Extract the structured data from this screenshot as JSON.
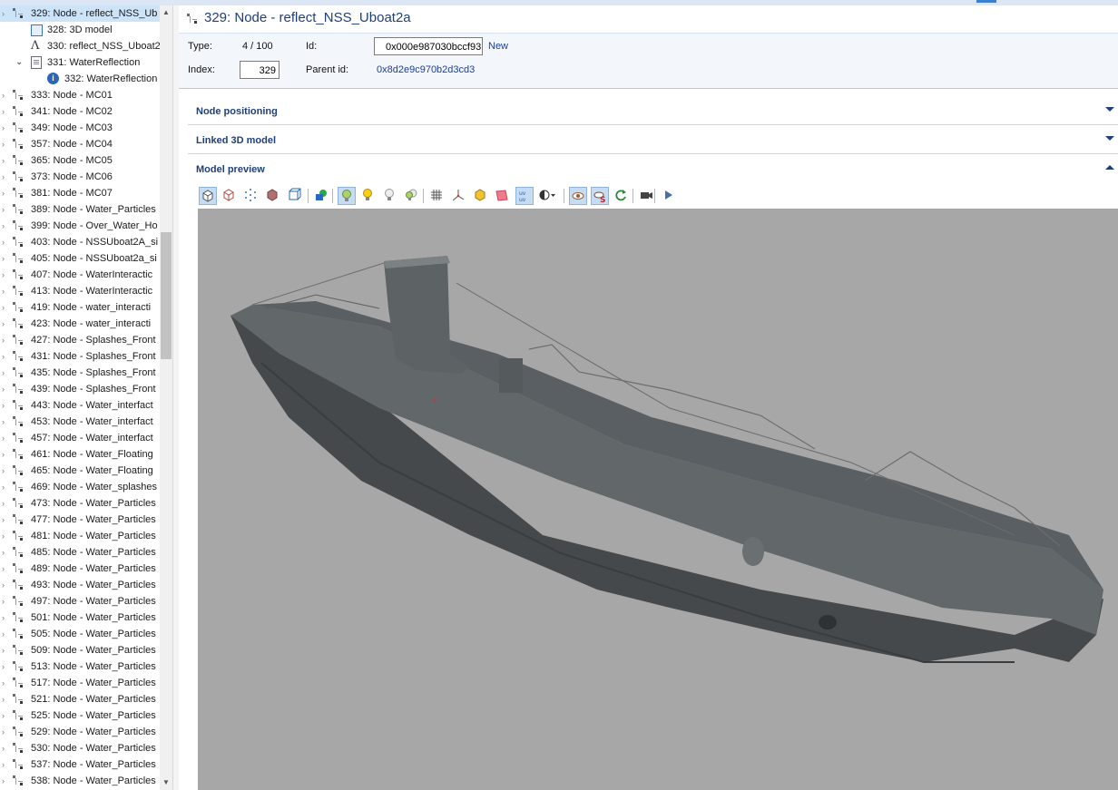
{
  "tree": {
    "items": [
      {
        "label": "329: Node - reflect_NSS_Ub",
        "icon": "node-icon",
        "selected": true
      },
      {
        "label": "328: 3D model",
        "icon": "model-icon"
      },
      {
        "label": "330: reflect_NSS_Uboat2",
        "icon": "lambda-icon"
      },
      {
        "label": "331: WaterReflection",
        "icon": "document-icon"
      },
      {
        "label": "332: WaterReflection",
        "icon": "info-icon"
      },
      {
        "label": "333: Node - MC01",
        "icon": "node-icon"
      },
      {
        "label": "341: Node - MC02",
        "icon": "node-icon"
      },
      {
        "label": "349: Node - MC03",
        "icon": "node-icon"
      },
      {
        "label": "357: Node - MC04",
        "icon": "node-icon"
      },
      {
        "label": "365: Node - MC05",
        "icon": "node-icon"
      },
      {
        "label": "373: Node - MC06",
        "icon": "node-icon"
      },
      {
        "label": "381: Node - MC07",
        "icon": "node-icon"
      },
      {
        "label": "389: Node - Water_Particles",
        "icon": "node-icon"
      },
      {
        "label": "399: Node - Over_Water_Ho",
        "icon": "node-icon"
      },
      {
        "label": "403: Node - NSSUboat2A_si",
        "icon": "node-icon"
      },
      {
        "label": "405: Node - NSSUboat2a_si",
        "icon": "node-icon"
      },
      {
        "label": "407: Node - WaterInteractic",
        "icon": "node-icon"
      },
      {
        "label": "413: Node - WaterInteractic",
        "icon": "node-icon"
      },
      {
        "label": "419: Node - water_interacti",
        "icon": "node-icon"
      },
      {
        "label": "423: Node - water_interacti",
        "icon": "node-icon"
      },
      {
        "label": "427: Node - Splashes_Front",
        "icon": "node-icon"
      },
      {
        "label": "431: Node - Splashes_Front",
        "icon": "node-icon"
      },
      {
        "label": "435: Node - Splashes_Front",
        "icon": "node-icon"
      },
      {
        "label": "439: Node - Splashes_Front",
        "icon": "node-icon"
      },
      {
        "label": "443: Node - Water_interfact",
        "icon": "node-icon"
      },
      {
        "label": "453: Node - Water_interfact",
        "icon": "node-icon"
      },
      {
        "label": "457: Node - Water_interfact",
        "icon": "node-icon"
      },
      {
        "label": "461: Node - Water_Floating",
        "icon": "node-icon"
      },
      {
        "label": "465: Node - Water_Floating",
        "icon": "node-icon"
      },
      {
        "label": "469: Node - Water_splashes",
        "icon": "node-icon"
      },
      {
        "label": "473: Node - Water_Particles",
        "icon": "node-icon"
      },
      {
        "label": "477: Node - Water_Particles",
        "icon": "node-icon"
      },
      {
        "label": "481: Node - Water_Particles",
        "icon": "node-icon"
      },
      {
        "label": "485: Node - Water_Particles",
        "icon": "node-icon"
      },
      {
        "label": "489: Node - Water_Particles",
        "icon": "node-icon"
      },
      {
        "label": "493: Node - Water_Particles",
        "icon": "node-icon"
      },
      {
        "label": "497: Node - Water_Particles",
        "icon": "node-icon"
      },
      {
        "label": "501: Node - Water_Particles",
        "icon": "node-icon"
      },
      {
        "label": "505: Node - Water_Particles",
        "icon": "node-icon"
      },
      {
        "label": "509: Node - Water_Particles",
        "icon": "node-icon"
      },
      {
        "label": "513: Node - Water_Particles",
        "icon": "node-icon"
      },
      {
        "label": "517: Node - Water_Particles",
        "icon": "node-icon"
      },
      {
        "label": "521: Node - Water_Particles",
        "icon": "node-icon"
      },
      {
        "label": "525: Node - Water_Particles",
        "icon": "node-icon"
      },
      {
        "label": "529: Node - Water_Particles",
        "icon": "node-icon"
      },
      {
        "label": "530: Node - Water_Particles",
        "icon": "node-icon"
      },
      {
        "label": "537: Node - Water_Particles",
        "icon": "node-icon"
      },
      {
        "label": "538: Node - Water_Particles",
        "icon": "node-icon"
      }
    ]
  },
  "header": {
    "title": "329: Node - reflect_NSS_Uboat2a"
  },
  "properties": {
    "type_label": "Type:",
    "type_value": "4 / 100",
    "id_label": "Id:",
    "id_value": "0x000e987030bccf93",
    "new_link": "New",
    "index_label": "Index:",
    "index_value": "329",
    "parent_label": "Parent id:",
    "parent_value": "0x8d2e9c970b2d3cd3"
  },
  "sections": {
    "positioning": "Node positioning",
    "linked": "Linked 3D model",
    "preview": "Model preview"
  },
  "toolbar": {
    "buttons": [
      {
        "icon": "solid-cube-icon",
        "active": true
      },
      {
        "icon": "wireframe-cube-icon"
      },
      {
        "icon": "points-icon"
      },
      {
        "icon": "shaded-cube-icon"
      },
      {
        "icon": "bounding-box-icon"
      },
      {
        "icon": "shapes-icon"
      },
      {
        "icon": "light-bulb-icon",
        "active": true
      },
      {
        "icon": "light-bulb-yellow-icon"
      },
      {
        "icon": "light-bulb-off-icon"
      },
      {
        "icon": "multi-light-icon"
      },
      {
        "icon": "grid-icon"
      },
      {
        "icon": "axes-icon"
      },
      {
        "icon": "box-yellow-icon"
      },
      {
        "icon": "plane-icon"
      },
      {
        "icon": "uv-icon",
        "active": true
      },
      {
        "icon": "shading-dropdown-icon"
      },
      {
        "icon": "eye-icon",
        "active": true
      },
      {
        "icon": "eye-s-icon",
        "active": true
      },
      {
        "icon": "refresh-icon"
      },
      {
        "icon": "camera-icon"
      },
      {
        "icon": "play-icon"
      }
    ]
  },
  "colors": {
    "accent": "#1f3f7a",
    "selection": "#cde3f7",
    "viewport_bg": "#a7a7a7",
    "hull": "#5b6063"
  }
}
